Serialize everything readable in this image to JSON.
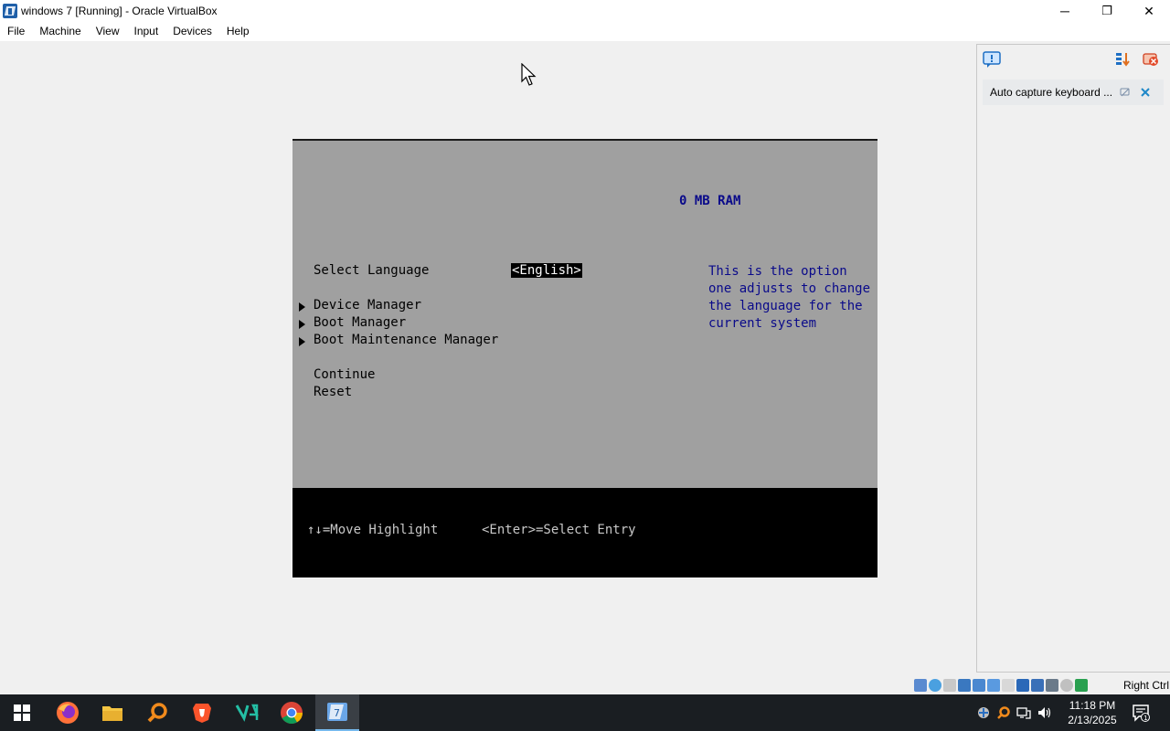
{
  "window": {
    "title": "windows 7 [Running] - Oracle VirtualBox",
    "controls": {
      "minimize": "─",
      "restore": "❐",
      "close": "✕"
    }
  },
  "menubar": {
    "items": [
      {
        "label": "File"
      },
      {
        "label": "Machine"
      },
      {
        "label": "View"
      },
      {
        "label": "Input"
      },
      {
        "label": "Devices"
      },
      {
        "label": "Help"
      }
    ]
  },
  "guest": {
    "ram": "0 MB RAM",
    "language_label": "Select Language",
    "language_value": "<English>",
    "help_lines": [
      "This is the option",
      "one adjusts to change",
      "the language for the",
      "current system"
    ],
    "menu": [
      {
        "label": "Device Manager",
        "submenu": true
      },
      {
        "label": "Boot Manager",
        "submenu": true
      },
      {
        "label": "Boot Maintenance Manager",
        "submenu": true
      },
      {
        "label": "Continue",
        "submenu": false
      },
      {
        "label": "Reset",
        "submenu": false
      }
    ],
    "footer": {
      "move": "↑↓=Move Highlight",
      "select": "<Enter>=Select Entry"
    }
  },
  "side_panel": {
    "notice": "Auto capture keyboard ..."
  },
  "statusbar": {
    "host_key": "Right Ctrl"
  },
  "taskbar": {
    "apps": [
      "start",
      "firefox",
      "file-explorer",
      "search-tool",
      "brave",
      "vs-code-insiders",
      "chrome",
      "virtualbox"
    ],
    "clock_time": "11:18 PM",
    "clock_date": "2/13/2025",
    "notification_count": "1"
  },
  "colors": {
    "guest_bg": "#a0a0a0",
    "guest_blue_text": "#0a0a8a",
    "taskbar_bg": "#1a1e22"
  }
}
